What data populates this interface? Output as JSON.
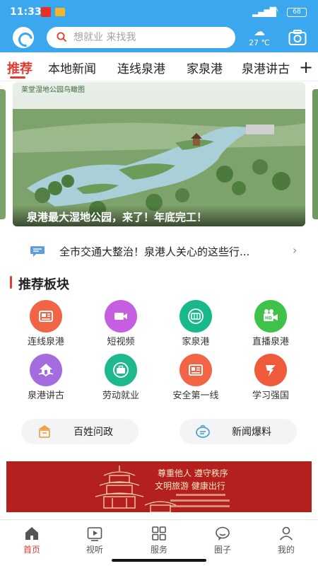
{
  "status": {
    "time": "11:33",
    "battery": "68"
  },
  "search": {
    "placeholder": "想就业 来找我"
  },
  "weather": {
    "temp": "27 ℃"
  },
  "tabs": [
    {
      "label": "推荐"
    },
    {
      "label": "本地新闻"
    },
    {
      "label": "连线泉港"
    },
    {
      "label": "家泉港"
    },
    {
      "label": "泉港讲古"
    }
  ],
  "banner": {
    "caption_top": "莱堂湿地公园鸟瞰图",
    "title": "泉港最大湿地公园，来了！年底完工！"
  },
  "ticker": {
    "text": "全市交通大整治！泉港人关心的这些行..."
  },
  "section": {
    "title": "推荐板块"
  },
  "grid": [
    {
      "label": "连线泉港",
      "icon": "newspaper-icon",
      "color": "#f26446"
    },
    {
      "label": "短视频",
      "icon": "video-camera-icon",
      "color": "#c55ee0"
    },
    {
      "label": "家泉港",
      "icon": "tv-grid-icon",
      "color": "#19b88a"
    },
    {
      "label": "直播泉港",
      "icon": "hd-camera-icon",
      "color": "#3fc24a"
    },
    {
      "label": "泉港讲古",
      "icon": "house-hands-icon",
      "color": "#a56cdf"
    },
    {
      "label": "劳动就业",
      "icon": "briefcase-icon",
      "color": "#1fb88e"
    },
    {
      "label": "安全第一线",
      "icon": "news-board-icon",
      "color": "#f26446"
    },
    {
      "label": "学习强国",
      "icon": "xuexi-icon",
      "color": "#f05a3c"
    }
  ],
  "pills": [
    {
      "label": "百姓问政",
      "icon": "people-ask-icon"
    },
    {
      "label": "新闻爆料",
      "icon": "news-tip-icon"
    }
  ],
  "ad": {
    "line1": "尊重他人 遵守秩序",
    "line2": "文明旅游 健康出行"
  },
  "nav": [
    {
      "label": "首页",
      "icon": "home-icon"
    },
    {
      "label": "视听",
      "icon": "play-icon"
    },
    {
      "label": "服务",
      "icon": "grid-icon"
    },
    {
      "label": "圈子",
      "icon": "chat-bubble-icon"
    },
    {
      "label": "我的",
      "icon": "person-icon"
    }
  ],
  "colors": {
    "brand": "#3aa7ee",
    "accent": "#e23c30",
    "ad_bg": "#b3201d"
  }
}
